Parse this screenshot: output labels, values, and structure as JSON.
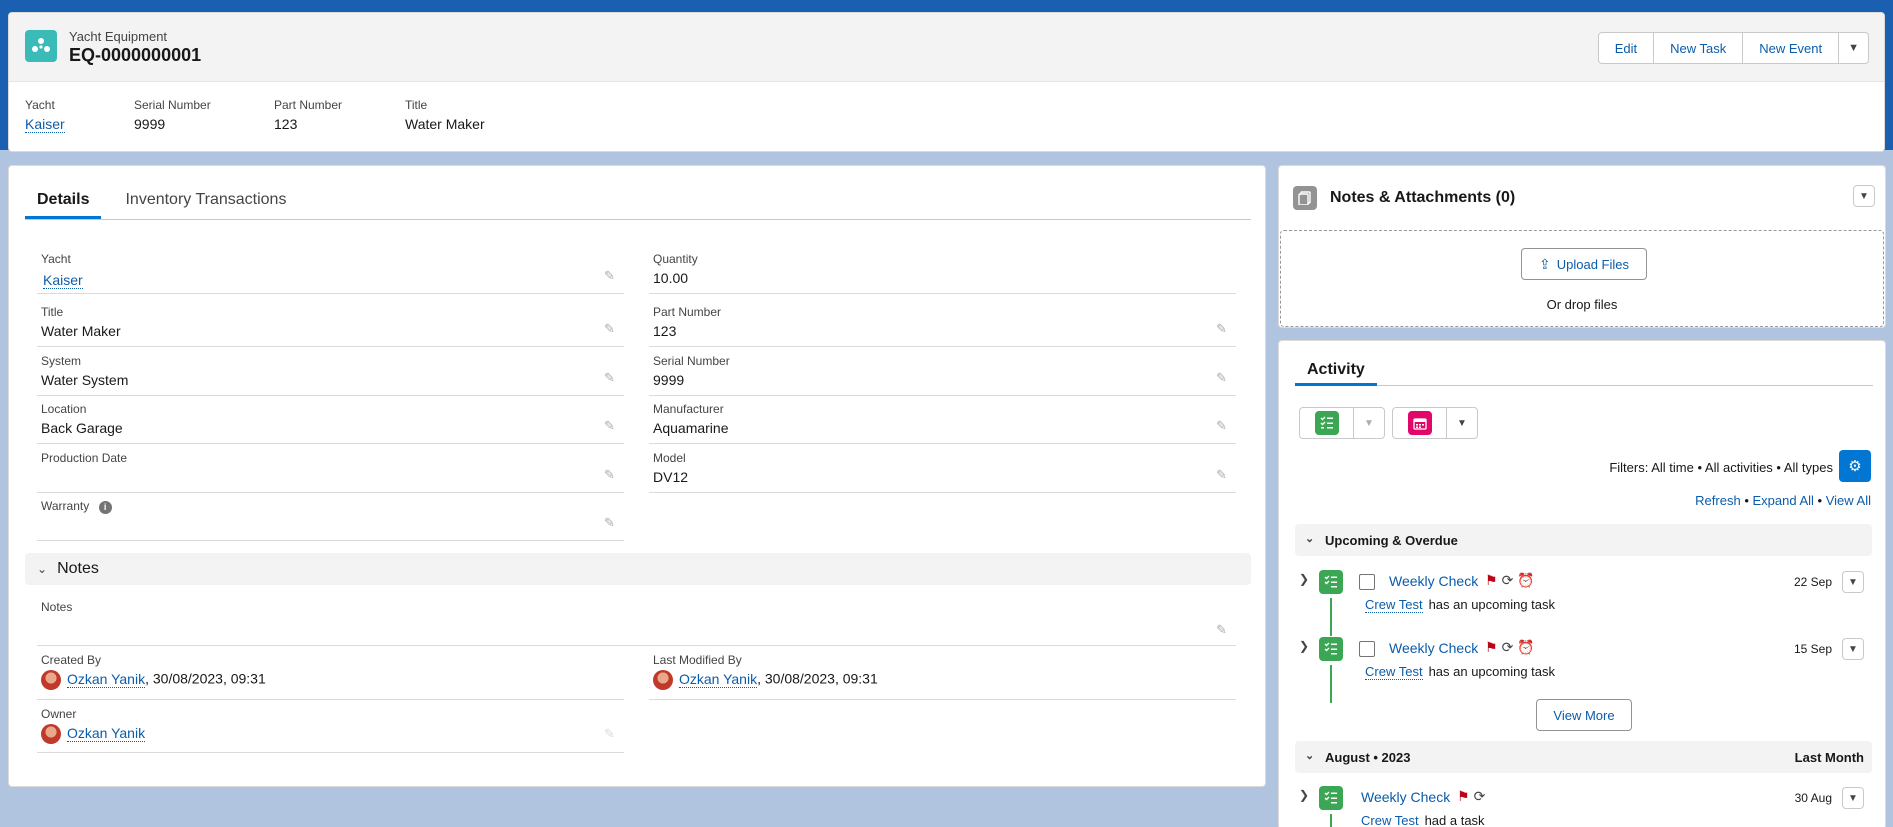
{
  "record": {
    "object_type": "Yacht Equipment",
    "name": "EQ-0000000001",
    "buttons": {
      "edit": "Edit",
      "new_task": "New Task",
      "new_event": "New Event"
    },
    "highlights": [
      {
        "label": "Yacht",
        "value": "Kaiser"
      },
      {
        "label": "Serial Number",
        "value": "9999"
      },
      {
        "label": "Part Number",
        "value": "123"
      },
      {
        "label": "Title",
        "value": "Water Maker"
      }
    ]
  },
  "tabs": {
    "details": "Details",
    "inventory": "Inventory Transactions"
  },
  "details": {
    "yacht": {
      "label": "Yacht",
      "value": "Kaiser"
    },
    "quantity": {
      "label": "Quantity",
      "value": "10.00"
    },
    "title": {
      "label": "Title",
      "value": "Water Maker"
    },
    "part_number": {
      "label": "Part Number",
      "value": "123"
    },
    "system": {
      "label": "System",
      "value": "Water System"
    },
    "serial_number": {
      "label": "Serial Number",
      "value": "9999"
    },
    "location": {
      "label": "Location",
      "value": "Back Garage"
    },
    "manufacturer": {
      "label": "Manufacturer",
      "value": "Aquamarine"
    },
    "production_date": {
      "label": "Production Date",
      "value": ""
    },
    "model": {
      "label": "Model",
      "value": "DV12"
    },
    "warranty": {
      "label": "Warranty",
      "value": ""
    }
  },
  "notes_section": {
    "title": "Notes",
    "notes": {
      "label": "Notes",
      "value": ""
    },
    "created_by": {
      "label": "Created By",
      "user": "Ozkan Yanik",
      "date": ", 30/08/2023, 09:31"
    },
    "last_modified_by": {
      "label": "Last Modified By",
      "user": "Ozkan Yanik",
      "date": ", 30/08/2023, 09:31"
    },
    "owner": {
      "label": "Owner",
      "user": "Ozkan Yanik"
    }
  },
  "attachments": {
    "title": "Notes & Attachments (0)",
    "upload": "Upload Files",
    "drop": "Or drop files"
  },
  "activity": {
    "tab": "Activity",
    "filters": "Filters: All time • All activities • All types",
    "refresh": "Refresh",
    "expand_all": "Expand All",
    "view_all": "View All",
    "sep": " • ",
    "upcoming": {
      "title": "Upcoming & Overdue",
      "tasks": [
        {
          "title": "Weekly Check",
          "date": "22 Sep",
          "who": "Crew Test",
          "text": "has an upcoming task"
        },
        {
          "title": "Weekly Check",
          "date": "15 Sep",
          "who": "Crew Test",
          "text": "has an upcoming task"
        }
      ],
      "view_more": "View More"
    },
    "august": {
      "title": "August • 2023",
      "right": "Last Month",
      "tasks": [
        {
          "title": "Weekly Check",
          "date": "30 Aug",
          "who": "Crew Test",
          "text": "had a task"
        }
      ]
    }
  },
  "colors": {
    "brand": "#0176d3",
    "link": "#0b5cab",
    "object_icon": "#3bbbb7",
    "task_icon": "#3ba755",
    "event_icon": "#e3066a",
    "flag": "#ba0517"
  }
}
